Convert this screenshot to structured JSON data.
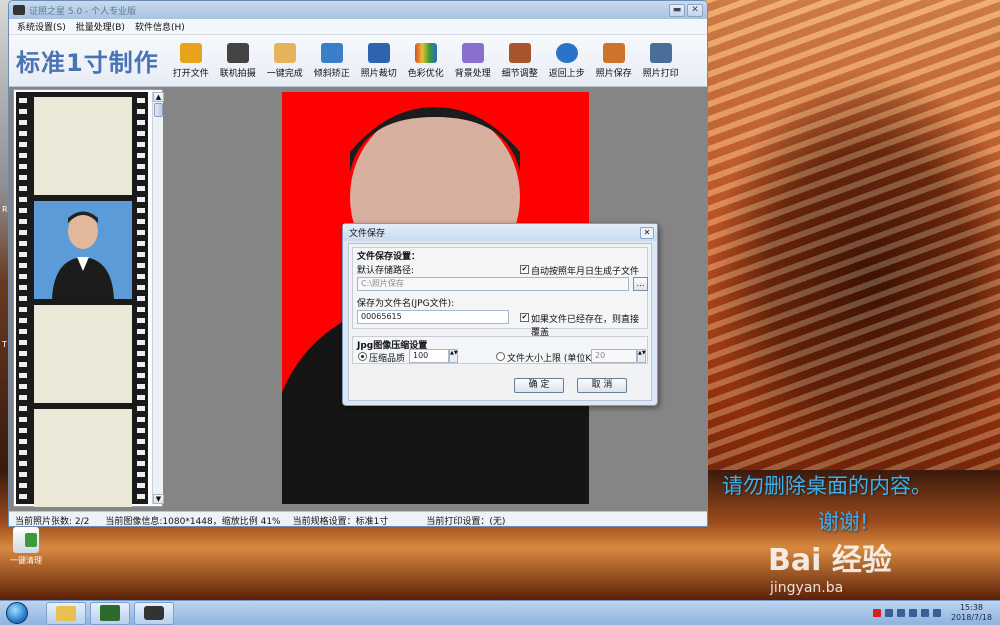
{
  "app": {
    "title": "证照之星 5.0 - 个人专业版",
    "brand": "标准1寸制作"
  },
  "menu": [
    "系统设置(S)",
    "批量处理(B)",
    "软件信息(H)"
  ],
  "toolbar": [
    {
      "label": "打开文件",
      "icon": "folder-icon",
      "color": "#e8a21c"
    },
    {
      "label": "联机拍摄",
      "icon": "camera-icon",
      "color": "#444444"
    },
    {
      "label": "一键完成",
      "icon": "hand-icon",
      "color": "#e6b35a"
    },
    {
      "label": "倾斜矫正",
      "icon": "rotate-icon",
      "color": "#3a7fc8"
    },
    {
      "label": "照片裁切",
      "icon": "crop-icon",
      "color": "#2e63b0"
    },
    {
      "label": "色彩优化",
      "icon": "color-icon",
      "color": "#d84a2a"
    },
    {
      "label": "背景处理",
      "icon": "brush-icon",
      "color": "#8a6fcf"
    },
    {
      "label": "细节调整",
      "icon": "histogram-icon",
      "color": "#a8552e"
    },
    {
      "label": "返回上步",
      "icon": "undo-icon",
      "color": "#2a73c8"
    },
    {
      "label": "照片保存",
      "icon": "floppy-icon",
      "color": "#d0732a"
    },
    {
      "label": "照片打印",
      "icon": "printer-icon",
      "color": "#4a6e9a"
    }
  ],
  "status": {
    "count": "当前照片张数: 2/2",
    "info": "当前图像信息:1080*1448，缩放比例 41%",
    "spec": "当前规格设置：标准1寸",
    "print": "当前打印设置：(无)"
  },
  "dialog": {
    "title": "文件保存",
    "section1": "文件保存设置：",
    "path_label": "默认存储路径:",
    "path_value": "C:\\照片保存",
    "auto_folder": "自动按照年月日生成子文件夹",
    "filename_label": "保存为文件名(JPG文件):",
    "filename_value": "00065615",
    "overwrite": "如果文件已经存在，则直接覆盖",
    "section2": "Jpg图像压缩设置",
    "quality_label": "压缩品质",
    "quality_value": "100",
    "size_label": "文件大小上限 (单位K)",
    "size_value": "20",
    "ok": "确  定",
    "cancel": "取  消"
  },
  "desktop": {
    "icon_label": "一键清理",
    "notice_line1": "请勿删除桌面的内容。",
    "notice_line2": "谢谢!",
    "watermark": "Bai 经验",
    "watermark_url": "jingyan.ba"
  },
  "taskbar": {
    "time": "15:38",
    "date": "2018/7/18"
  }
}
